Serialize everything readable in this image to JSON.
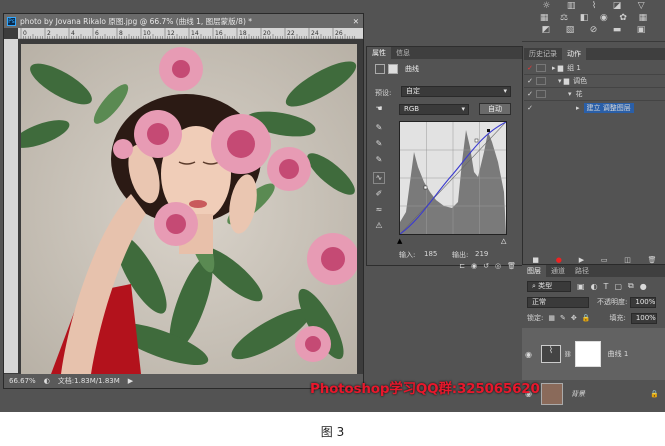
{
  "document": {
    "title": "photo by Jovana Rikalo 原图.jpg @ 66.7% (曲线 1, 图层蒙版/8) *",
    "app_icon": "Ps",
    "zoom": "66.67%",
    "doc_size": "文档:1.83M/1.83M",
    "ruler_marks": [
      "0",
      "2",
      "4",
      "6",
      "8",
      "10",
      "12",
      "14",
      "16",
      "18",
      "20",
      "22",
      "24",
      "26"
    ]
  },
  "properties": {
    "tabs": [
      "属性",
      "信息"
    ],
    "panel_title": "曲线",
    "preset_label": "预设:",
    "preset_value": "自定",
    "channel_value": "RGB",
    "auto_button": "自动",
    "input_label": "输入:",
    "input_value": "185",
    "output_label": "输出:",
    "output_value": "219"
  },
  "actions": {
    "tabs": [
      "历史记录",
      "动作"
    ],
    "items": [
      {
        "label": "组 1",
        "indent": 0
      },
      {
        "label": "调色",
        "indent": 1
      },
      {
        "label": "花",
        "indent": 2
      },
      {
        "label": "建立 调整图层",
        "indent": 3
      }
    ]
  },
  "layers": {
    "tabs": [
      "图层",
      "通道",
      "路径"
    ],
    "filter_label": "类型",
    "blend_mode": "正常",
    "opacity_label": "不透明度:",
    "opacity_value": "100%",
    "lock_label": "锁定:",
    "fill_label": "填充:",
    "fill_value": "100%",
    "items": [
      {
        "name": "曲线 1"
      },
      {
        "name": "背景"
      }
    ]
  },
  "watermark": "Photoshop学习QQ群:325065620",
  "caption": "图 3",
  "colors": {
    "ui_bg": "#535353",
    "watermark": "#e8182c",
    "curve": "#3a3ad0"
  }
}
